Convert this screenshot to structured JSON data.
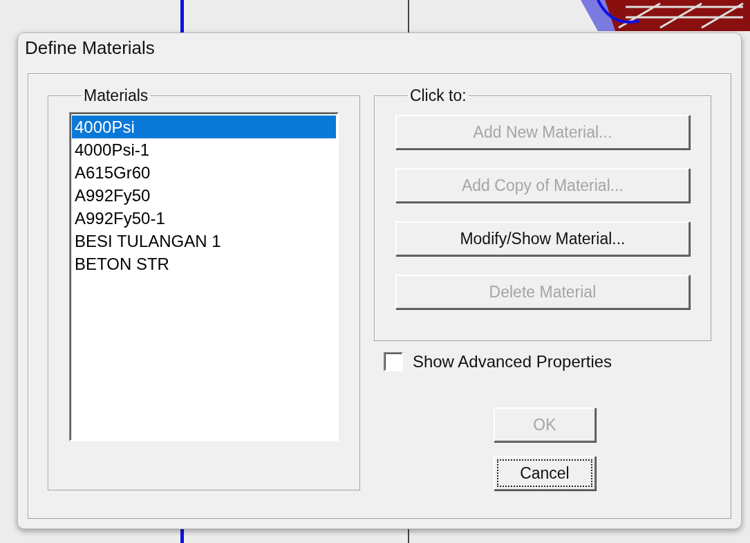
{
  "window": {
    "title": "Define Materials"
  },
  "materials": {
    "label": "Materials",
    "items": [
      {
        "name": "4000Psi",
        "selected": true
      },
      {
        "name": "4000Psi-1",
        "selected": false
      },
      {
        "name": "A615Gr60",
        "selected": false
      },
      {
        "name": "A992Fy50",
        "selected": false
      },
      {
        "name": "A992Fy50-1",
        "selected": false
      },
      {
        "name": "BESI TULANGAN 1",
        "selected": false
      },
      {
        "name": "BETON STR",
        "selected": false
      }
    ]
  },
  "click_to": {
    "label": "Click to:",
    "buttons": [
      {
        "label": "Add New Material...",
        "disabled": true
      },
      {
        "label": "Add Copy of Material...",
        "disabled": true
      },
      {
        "label": "Modify/Show Material...",
        "disabled": false
      },
      {
        "label": "Delete Material",
        "disabled": true
      }
    ]
  },
  "show_advanced": {
    "label": "Show Advanced Properties",
    "checked": false
  },
  "buttons": [
    {
      "label": "OK",
      "disabled": true,
      "focused": false
    },
    {
      "label": "Cancel",
      "disabled": false,
      "focused": true
    }
  ]
}
